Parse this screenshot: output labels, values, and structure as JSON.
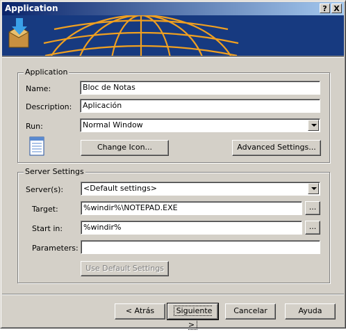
{
  "window": {
    "title": "Application",
    "help_btn": "?",
    "close_btn": "X"
  },
  "application": {
    "group_label": "Application",
    "name_label": "Name:",
    "name_value": "Bloc de Notas",
    "description_label": "Description:",
    "description_value": "Aplicación",
    "run_label": "Run:",
    "run_value": "Normal Window",
    "change_icon_label": "Change Icon...",
    "advanced_settings_label": "Advanced Settings..."
  },
  "server": {
    "group_label": "Server Settings",
    "servers_label": "Server(s):",
    "servers_value": "<Default settings>",
    "target_label": "Target:",
    "target_value": "%windir%\\NOTEPAD.EXE",
    "browse_label": "...",
    "start_in_label": "Start in:",
    "start_in_value": "%windir%",
    "parameters_label": "Parameters:",
    "parameters_value": "",
    "use_default_label": "Use Default Settings"
  },
  "footer": {
    "back_label": "< Atrás",
    "next_label": "Siguiente >",
    "cancel_label": "Cancelar",
    "help_label": "Ayuda"
  },
  "colors": {
    "title_start": "#0a246a",
    "title_end": "#a6caf0",
    "banner": "#173a80",
    "globe": "#f0a020"
  }
}
